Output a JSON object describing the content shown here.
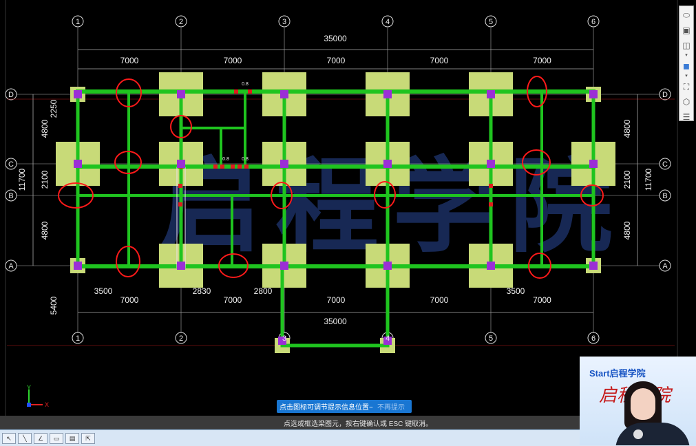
{
  "axes": {
    "columns": [
      "1",
      "2",
      "3",
      "4",
      "5",
      "6"
    ],
    "rows": [
      "A",
      "B",
      "C",
      "D"
    ]
  },
  "dims": {
    "top_total": "35000",
    "top_spans": [
      "7000",
      "7000",
      "7000",
      "7000",
      "7000"
    ],
    "bottom_partial_left": "3500",
    "bottom_partial_mid1": "2830",
    "bottom_partial_mid2": "2800",
    "bottom_partial_right": "3500",
    "bottom_spans": [
      "7000",
      "7000",
      "7000",
      "7000",
      "7000"
    ],
    "bottom_total": "35000",
    "left_d_c": "4800",
    "left_d_partial": "2250",
    "left_c_b": "2100",
    "left_b_a": "4800",
    "left_total": "11700",
    "left_ext": "5400",
    "right_d_c": "4800",
    "right_c_b": "2100",
    "right_b_a": "4800",
    "right_total": "11700",
    "small_tag": "0.8"
  },
  "watermark": "启程学院",
  "colors": {
    "beam": "#1fc41f",
    "column": "#9b2fd6",
    "footing": "#c8da78",
    "grid": "#b0b0b0",
    "highlight": "#ff1a1a"
  },
  "toolbar_icons": [
    "shape-icon",
    "3d-box-icon",
    "view-cube-icon",
    "dropdown-arrow-icon",
    "solid-cube-icon",
    "fullscreen-icon",
    "settings-cube-icon",
    "checklist-icon"
  ],
  "tip": {
    "message": "点击图标可调节提示信息位置~",
    "dismiss": "不再提示"
  },
  "status": {
    "prompt": "点选或框选梁图元，按右键确认或 ESC 键取消。"
  },
  "video": {
    "logo": "Start启程学院",
    "calligraphy": "启程学院"
  },
  "coord": {
    "y": "Y",
    "x": "X"
  }
}
